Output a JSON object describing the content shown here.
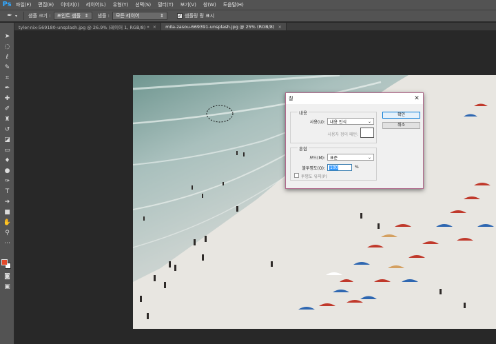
{
  "app": {
    "logo": "Ps"
  },
  "menu": [
    "파일(F)",
    "편집(E)",
    "이미지(I)",
    "레이어(L)",
    "유형(Y)",
    "선택(S)",
    "필터(T)",
    "보기(V)",
    "창(W)",
    "도움말(H)"
  ],
  "options": {
    "tool_icon": "eyedropper-icon",
    "sample_size_label": "샘플 크기 :",
    "sample_size_value": "포인트 샘플",
    "sample_label": "샘플 :",
    "sample_value": "모든 레이어",
    "show_ring_label": "샘플링 링 표시",
    "show_ring_checked": true
  },
  "tabs": [
    {
      "label": "tyler-nix-569180-unsplash.jpg @ 26.9% (레이어 1, RGB/8) *",
      "active": false
    },
    {
      "label": "mila-zasou-669391-unsplash.jpg @ 25% (RGB/8)",
      "active": true
    }
  ],
  "colors": {
    "foreground": "#e34a2b",
    "background": "#ffffff",
    "dialog_border": "#b06a8c"
  },
  "dialog": {
    "title": "칠",
    "close": "✕",
    "contents_group": "내용",
    "use_label": "사용(U):",
    "use_value": "내용 인식",
    "custom_pattern_label": "사용자 정의 패턴:",
    "blending_group": "혼합",
    "mode_label": "모드(M):",
    "mode_value": "표준",
    "opacity_label": "불투명도(O):",
    "opacity_value": "100",
    "opacity_unit": "%",
    "preserve_label": "투명도 유지(P)",
    "ok_label": "확인",
    "cancel_label": "취소"
  }
}
